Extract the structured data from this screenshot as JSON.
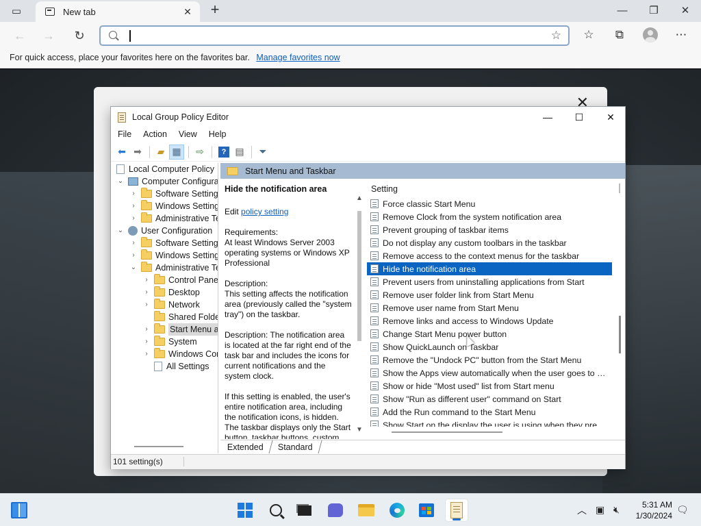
{
  "browser": {
    "tab": {
      "title": "New tab"
    },
    "address": {
      "value": "",
      "placeholder": ""
    },
    "favbar": {
      "message": "For quick access, place your favorites here on the favorites bar.",
      "link": "Manage favorites now"
    }
  },
  "gpe": {
    "title": "Local Group Policy Editor",
    "menu": [
      "File",
      "Action",
      "View",
      "Help"
    ],
    "tree": [
      {
        "label": "Local Computer Policy",
        "icon": "doc-icon",
        "depth": 0,
        "chevron": ""
      },
      {
        "label": "Computer Configura",
        "icon": "computer-icon",
        "depth": 0,
        "chevron": "open"
      },
      {
        "label": "Software Settings",
        "icon": "folder-icon",
        "depth": 1,
        "chevron": "closed"
      },
      {
        "label": "Windows Setting",
        "icon": "folder-icon",
        "depth": 1,
        "chevron": "closed"
      },
      {
        "label": "Administrative Te",
        "icon": "folder-icon",
        "depth": 1,
        "chevron": "closed"
      },
      {
        "label": "User Configuration",
        "icon": "user-icon",
        "depth": 0,
        "chevron": "open"
      },
      {
        "label": "Software Settings",
        "icon": "folder-icon",
        "depth": 1,
        "chevron": "closed"
      },
      {
        "label": "Windows Setting",
        "icon": "folder-icon",
        "depth": 1,
        "chevron": "closed"
      },
      {
        "label": "Administrative Te",
        "icon": "folder-icon",
        "depth": 1,
        "chevron": "open"
      },
      {
        "label": "Control Panel",
        "icon": "folder-icon",
        "depth": 2,
        "chevron": "closed"
      },
      {
        "label": "Desktop",
        "icon": "folder-icon",
        "depth": 2,
        "chevron": "closed"
      },
      {
        "label": "Network",
        "icon": "folder-icon",
        "depth": 2,
        "chevron": "closed"
      },
      {
        "label": "Shared Folder",
        "icon": "folder-icon",
        "depth": 2,
        "chevron": ""
      },
      {
        "label": "Start Menu ar",
        "icon": "folder-icon",
        "depth": 2,
        "chevron": "closed",
        "selected": true
      },
      {
        "label": "System",
        "icon": "folder-icon",
        "depth": 2,
        "chevron": "closed"
      },
      {
        "label": "Windows Cor",
        "icon": "folder-icon",
        "depth": 2,
        "chevron": "closed"
      },
      {
        "label": "All Settings",
        "icon": "doc-icon",
        "depth": 2,
        "chevron": ""
      }
    ],
    "pane_header": "Start Menu and Taskbar",
    "description": {
      "title": "Hide the notification area",
      "edit_prefix": "Edit",
      "edit_link": "policy setting",
      "req_label": "Requirements:",
      "req_text": "At least Windows Server 2003 operating systems or Windows XP Professional",
      "desc_label": "Description:",
      "desc_text": "This setting affects the notification area (previously called the \"system tray\") on the taskbar.",
      "desc_text2": "Description: The notification area is located at the far right end of the task bar and includes the icons for current notifications and the system clock.",
      "desc_text3": "If this setting is enabled, the user's entire notification area, including the notification icons, is hidden. The taskbar displays only the Start button, taskbar buttons, custom"
    },
    "list_header": "Setting",
    "settings": [
      "Force classic Start Menu",
      "Remove Clock from the system notification area",
      "Prevent grouping of taskbar items",
      "Do not display any custom toolbars in the taskbar",
      "Remove access to the context menus for the taskbar",
      "Hide the notification area",
      "Prevent users from uninstalling applications from Start",
      "Remove user folder link from Start Menu",
      "Remove user name from Start Menu",
      "Remove links and access to Windows Update",
      "Change Start Menu power button",
      "Show QuickLaunch on Taskbar",
      "Remove the \"Undock PC\" button from the Start Menu",
      "Show the Apps view automatically when the user goes to St...",
      "Show or hide \"Most used\" list from Start menu",
      "Show \"Run as different user\" command on Start",
      "Add the Run command to the Start Menu",
      "Show Start on the display the user is using when they press t"
    ],
    "selected_index": 5,
    "tabs": [
      "Extended",
      "Standard"
    ],
    "status": "101 setting(s)"
  },
  "taskbar": {
    "time": "5:31 AM",
    "date": "1/30/2024"
  },
  "colors": {
    "selection": "#0a64c2",
    "pane_header": "#a6bbd2",
    "link": "#0a5fbf"
  }
}
